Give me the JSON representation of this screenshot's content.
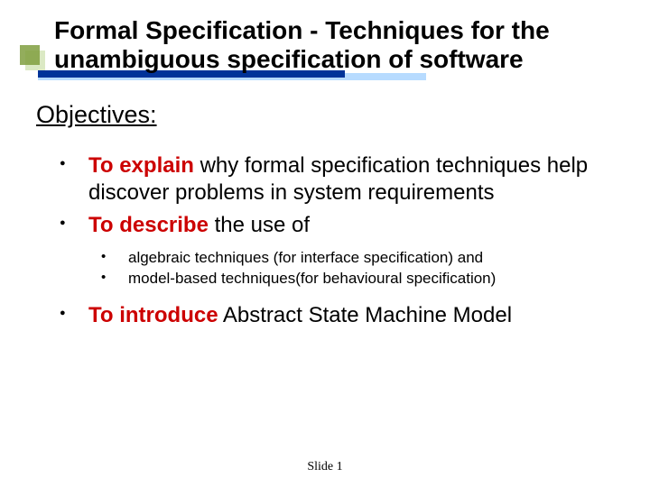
{
  "title": {
    "line1": "Formal Specification - Techniques for the",
    "line2": "unambiguous specification of software"
  },
  "section_heading": "Objectives:",
  "bullets": [
    {
      "bold": "To explain",
      "rest": " why formal specification techniques help discover problems in system requirements"
    },
    {
      "bold": "To describe",
      "rest": " the use of"
    }
  ],
  "sub_bullets": [
    "algebraic techniques (for interface specification) and",
    "model-based techniques(for behavioural specification)"
  ],
  "bullet_last": {
    "bold": "To introduce",
    "rest": " Abstract State Machine Model"
  },
  "footer": "Slide  1"
}
